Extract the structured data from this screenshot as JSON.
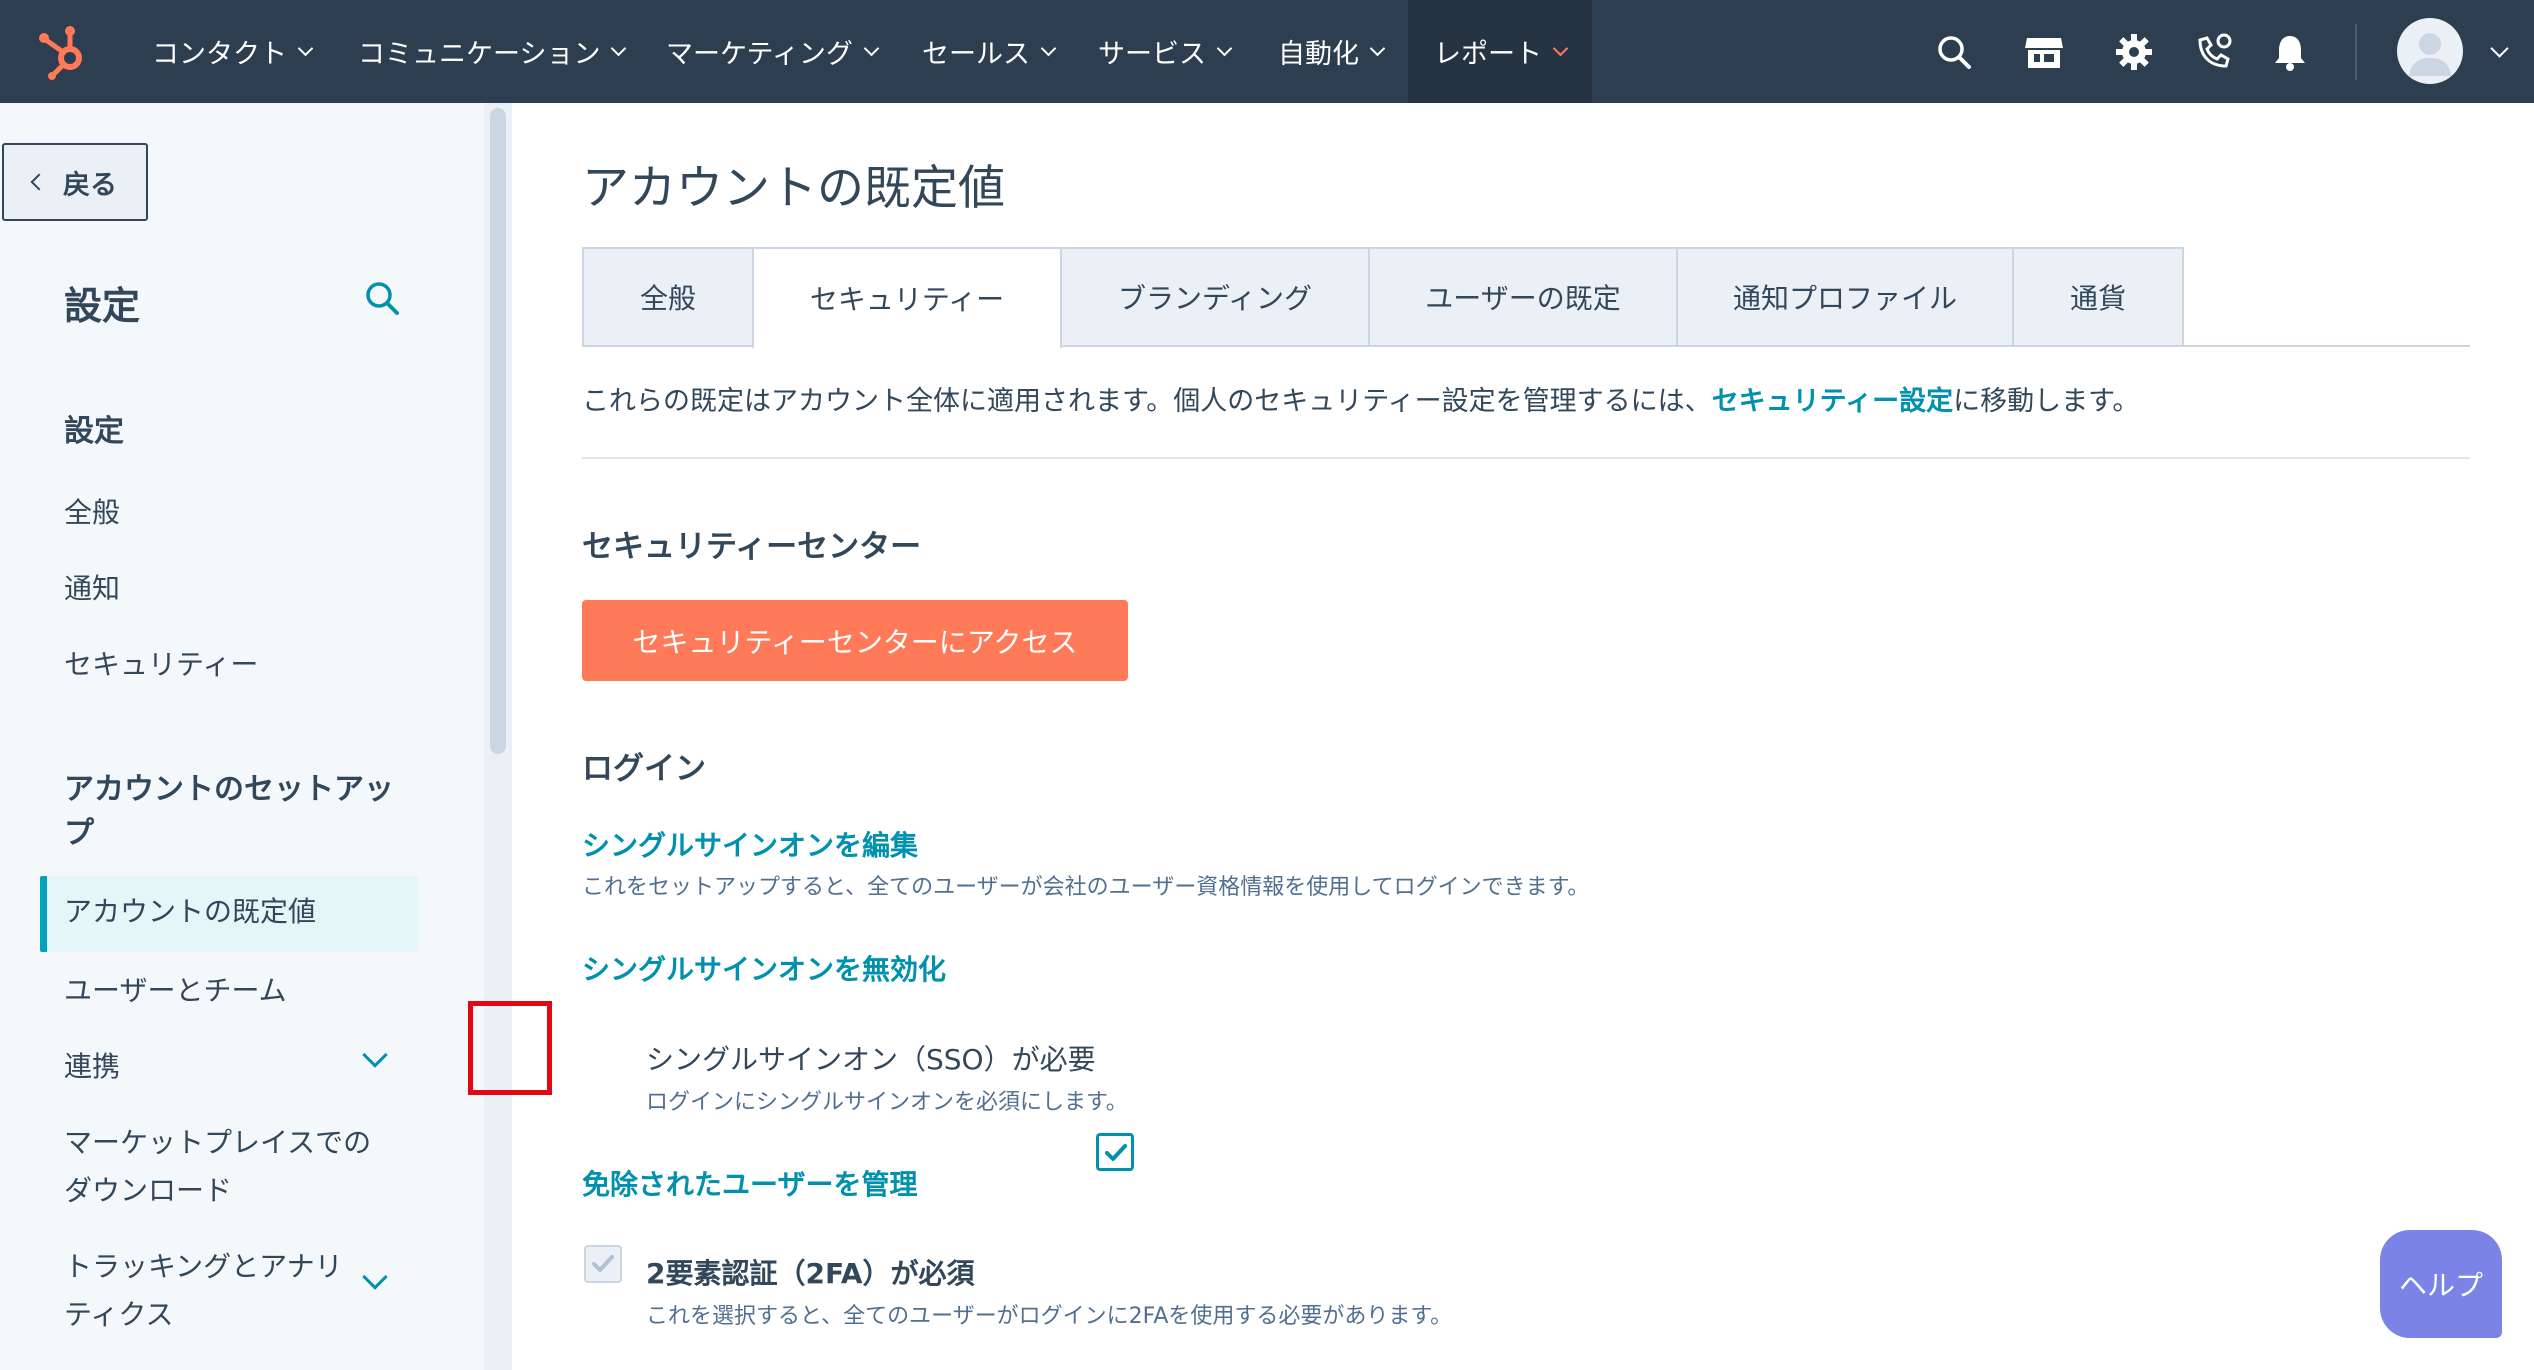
{
  "topnav": {
    "items": [
      {
        "label": "コンタクト"
      },
      {
        "label": "コミュニケーション"
      },
      {
        "label": "マーケティング"
      },
      {
        "label": "セールス"
      },
      {
        "label": "サービス"
      },
      {
        "label": "自動化"
      },
      {
        "label": "レポート"
      }
    ],
    "icons": [
      "search-icon",
      "marketplace-icon",
      "settings-gear-icon",
      "calling-icon",
      "notifications-bell-icon"
    ],
    "brand_color": "#ff7a59",
    "bg_color": "#2d3e50"
  },
  "sidebar": {
    "back_label": "戻る",
    "title": "設定",
    "sections": [
      {
        "heading": "設定",
        "items": [
          "全般",
          "通知",
          "セキュリティー"
        ]
      },
      {
        "heading": "アカウントのセットアップ",
        "items": [
          "アカウントの既定値",
          "ユーザーとチーム",
          "連携",
          "マーケットプレイスでのダウンロード",
          "トラッキングとアナリティクス"
        ]
      }
    ],
    "heading_2_lines": [
      "アカウントのセットアッ",
      "プ"
    ],
    "active_item": "アカウントの既定値",
    "marketplace_lines": [
      "マーケットプレイスでの",
      "ダウンロード"
    ],
    "tracking_lines": [
      "トラッキングとアナリ",
      "ティクス"
    ]
  },
  "main": {
    "page_title": "アカウントの既定値",
    "tabs": [
      {
        "label": "全般",
        "active": false
      },
      {
        "label": "セキュリティー",
        "active": true
      },
      {
        "label": "ブランディング",
        "active": false
      },
      {
        "label": "ユーザーの既定",
        "active": false
      },
      {
        "label": "通知プロファイル",
        "active": false
      },
      {
        "label": "通貨",
        "active": false
      }
    ],
    "intro_prefix": "これらの既定はアカウント全体に適用されます。個人のセキュリティー設定を管理するには、",
    "intro_link": "セキュリティー設定",
    "intro_suffix": "に移動します。",
    "security_center": {
      "heading": "セキュリティーセンター",
      "button_label": "セキュリティーセンターにアクセス"
    },
    "login": {
      "heading": "ログイン",
      "edit_sso_link": "シングルサインオンを編集",
      "edit_sso_desc": "これをセットアップすると、全てのユーザーが会社のユーザー資格情報を使用してログインできます。",
      "disable_sso_link": "シングルサインオンを無効化",
      "sso_required": {
        "label": "シングルサインオン（SSO）が必要",
        "desc": "ログインにシングルサインオンを必須にします。",
        "checked": true
      },
      "manage_exempt_link": "免除されたユーザーを管理",
      "twofa_required": {
        "label": "2要素認証（2FA）が必須",
        "desc": "これを選択すると、全てのユーザーがログインに2FAを使用する必要があります。",
        "checked": true,
        "disabled": true
      }
    }
  },
  "help_button": {
    "label": "ヘルプ",
    "color": "#7b83e6"
  }
}
